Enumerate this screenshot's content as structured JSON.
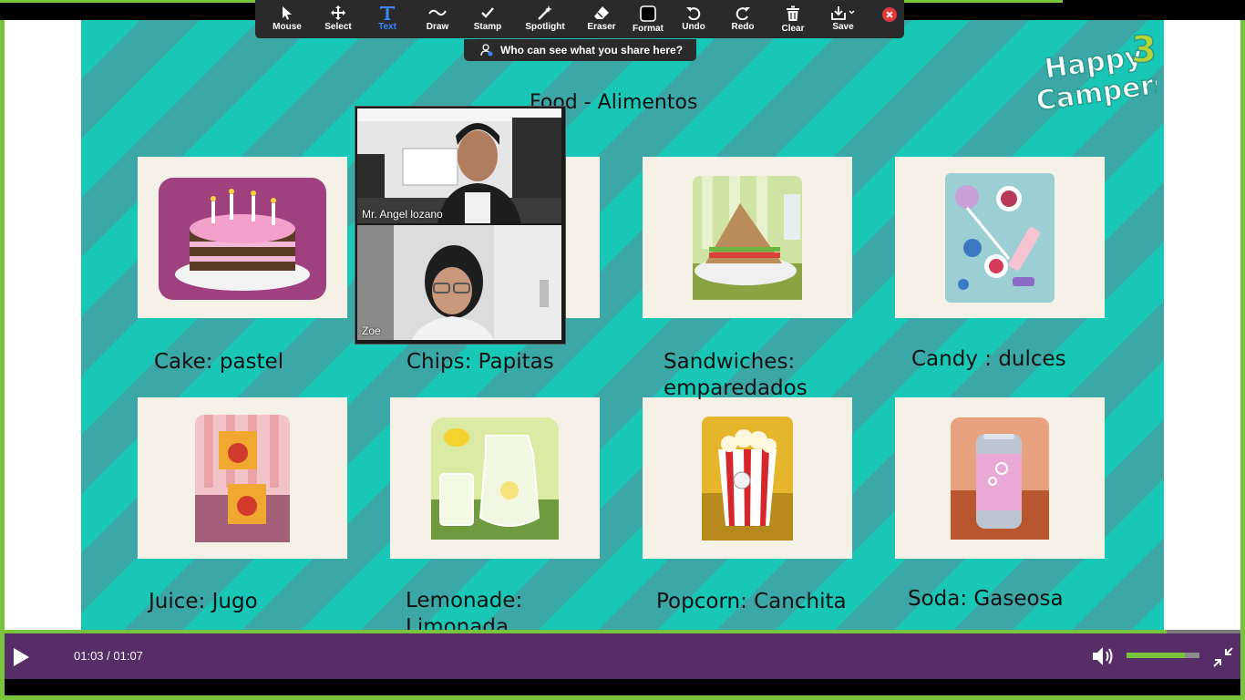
{
  "toolbar": {
    "tools": [
      {
        "label": "Mouse",
        "icon": "mouse-pointer-icon"
      },
      {
        "label": "Select",
        "icon": "move-arrows-icon"
      },
      {
        "label": "Text",
        "icon": "text-t-icon"
      },
      {
        "label": "Draw",
        "icon": "squiggle-draw-icon"
      },
      {
        "label": "Stamp",
        "icon": "checkmark-stamp-icon"
      },
      {
        "label": "Spotlight",
        "icon": "magic-wand-icon"
      },
      {
        "label": "Eraser",
        "icon": "eraser-icon"
      },
      {
        "label": "Format",
        "icon": "square-format-icon"
      },
      {
        "label": "Undo",
        "icon": "undo-arrow-icon"
      },
      {
        "label": "Redo",
        "icon": "redo-arrow-icon"
      },
      {
        "label": "Clear",
        "icon": "trash-icon"
      },
      {
        "label": "Save",
        "icon": "download-save-icon"
      }
    ],
    "active_tool": "Text",
    "visibility_text": "Who can see what you share here?"
  },
  "slide": {
    "title": "Food - Alimentos",
    "logo_text": "Happy Campers",
    "logo_number": "3",
    "items": [
      {
        "label": "Cake: pastel",
        "picture": "cake"
      },
      {
        "label": "Chips: Papitas",
        "picture": "chips"
      },
      {
        "label": "Sandwiches:\nemparedados",
        "picture": "sandwich"
      },
      {
        "label": "Candy : dulces",
        "picture": "candy"
      },
      {
        "label": "Juice: Jugo",
        "picture": "juice"
      },
      {
        "label": "Lemonade:\nLimonada",
        "picture": "lemonade"
      },
      {
        "label": "Popcorn: Canchita",
        "picture": "popcorn"
      },
      {
        "label": "Soda: Gaseosa",
        "picture": "soda"
      }
    ]
  },
  "participants": [
    {
      "name": "Mr. Angel lozano"
    },
    {
      "name": "Zoe"
    }
  ],
  "player": {
    "time_display": "01:03 / 01:07",
    "progress_fraction": 0.94,
    "volume_fraction": 0.8
  },
  "colors": {
    "accent_green": "#78c43b",
    "player_purple": "#572d68",
    "slide_teal": "#18c7b6",
    "active_tool_blue": "#3a86ff"
  }
}
